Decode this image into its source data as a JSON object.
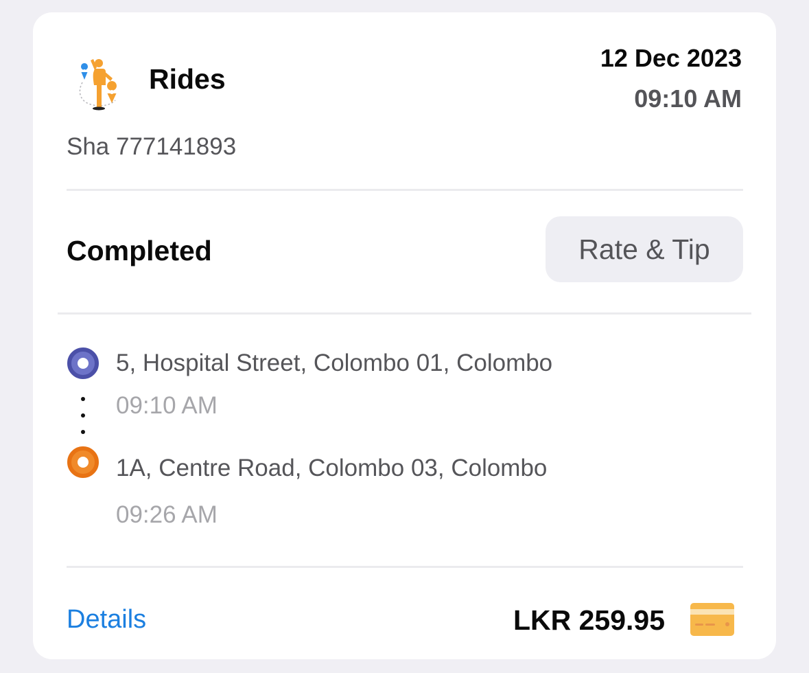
{
  "ride": {
    "service_name": "Rides",
    "service_icon": "rides-person-pin-icon",
    "date": "12 Dec 2023",
    "time": "09:10 AM",
    "driver_info": "Sha 777141893",
    "status": "Completed",
    "rate_button_label": "Rate & Tip"
  },
  "route": {
    "pickup": {
      "address": "5, Hospital Street, Colombo 01, Colombo",
      "time": "09:10 AM",
      "icon": "pickup-marker-icon",
      "color": "#5a5fb8"
    },
    "dropoff": {
      "address": "1A, Centre Road, Colombo 03, Colombo",
      "time": "09:26 AM",
      "icon": "dropoff-marker-icon",
      "color": "#f08a2a"
    }
  },
  "footer": {
    "details_label": "Details",
    "fare": "LKR 259.95",
    "payment_icon": "credit-card-icon"
  },
  "colors": {
    "background": "#f0eff4",
    "card": "#ffffff",
    "link": "#1b7fe0",
    "accent_orange": "#f5a130"
  }
}
